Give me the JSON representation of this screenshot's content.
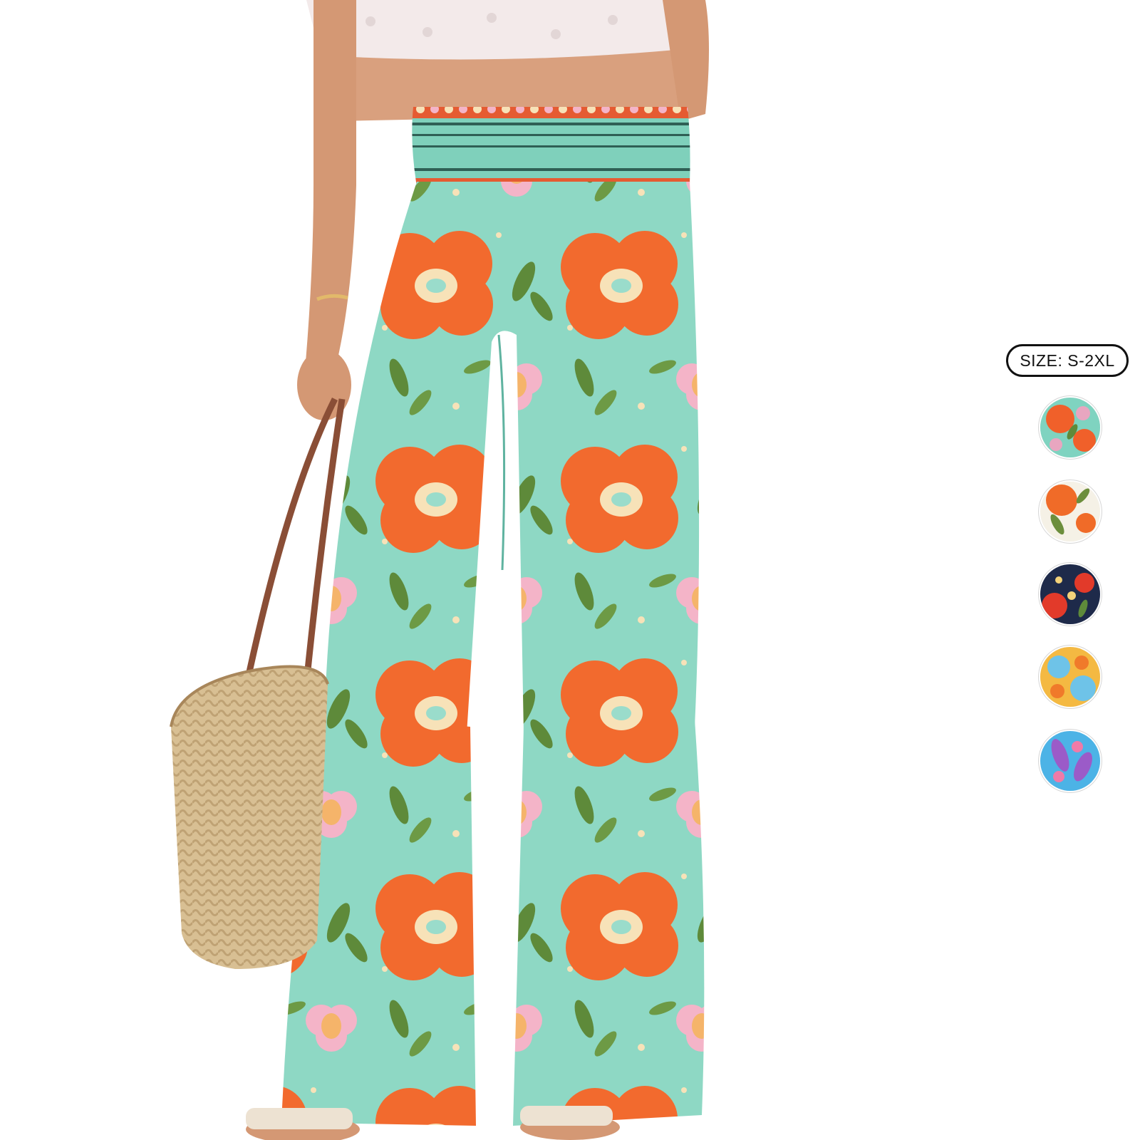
{
  "product": {
    "size_label": "SIZE: S-2XL",
    "print_colors": {
      "mint": "#8ED8C4",
      "orange": "#F26A2E",
      "pink": "#F4B4C8",
      "leaf": "#5E8A3A",
      "cream": "#F7E2B8",
      "waistband_accent": "#E55B32"
    }
  },
  "swatches": [
    {
      "name": "mint-floral",
      "base": "#7FD3C0",
      "accent": "#F0602A",
      "accent2": "#E8A6C0"
    },
    {
      "name": "white-orange-floral",
      "base": "#F5F1E6",
      "accent": "#F06B28",
      "accent2": "#6C8E3C"
    },
    {
      "name": "navy-red-floral",
      "base": "#1E2A4A",
      "accent": "#E23A2A",
      "accent2": "#F3D27A"
    },
    {
      "name": "yellow-blue-floral",
      "base": "#F4B942",
      "accent": "#6EC3E8",
      "accent2": "#F07A2A"
    },
    {
      "name": "blue-purple-floral",
      "base": "#4CB3E6",
      "accent": "#9B5BC8",
      "accent2": "#F07AA8"
    }
  ]
}
